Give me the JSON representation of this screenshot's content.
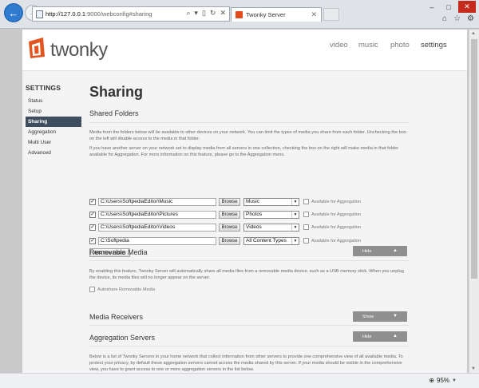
{
  "browser": {
    "url_host": "http://127.0.0.1",
    "url_rest": ":9000/webconfig#sharing",
    "tab_title": "Twonky Server",
    "zoom": "95%"
  },
  "brand": {
    "logo_text": "twonky",
    "accent": "#e2551f"
  },
  "topnav": [
    "video",
    "music",
    "photo",
    "settings"
  ],
  "sidebar": {
    "title": "SETTINGS",
    "items": [
      "Status",
      "Setup",
      "Sharing",
      "Aggregation",
      "Multi User",
      "Advanced"
    ],
    "active_index": 2
  },
  "main": {
    "title": "Sharing",
    "shared_folders": {
      "title": "Shared Folders",
      "para1": "Media from the folders below will be available to other devices on your network. You can limit the types of media you share from each folder. Unchecking the box on the left will disable access to the media in that folder.",
      "para2": "If you have another server on your network set to display media from all servers in one collection, checking the box on the right will make media in that folder available for Aggregation. For more information on this feature, please go to the Aggregation menu.",
      "browse_label": "Browse",
      "aggregation_label": "Available for Aggregation",
      "folders": [
        {
          "path": "C:\\Users\\SoftpediaEditor\\Music",
          "type": "Music",
          "checked": true
        },
        {
          "path": "C:\\Users\\SoftpediaEditor\\Pictures",
          "type": "Photos",
          "checked": true
        },
        {
          "path": "C:\\Users\\SoftpediaEditor\\Videos",
          "type": "Videos",
          "checked": true
        },
        {
          "path": "C:\\Softpedia",
          "type": "All Content Types",
          "checked": true
        }
      ],
      "add_button": "Add New Folder"
    },
    "removable_media": {
      "title": "Removable Media",
      "toggle_label": "Hide",
      "para": "By enabling this feature, Twonky Server will automatically share all media files from a removable media device, such as a USB memory stick. When you unplug the device, its media files will no longer appear on the server.",
      "autoshare_label": "Autoshare Removable Media"
    },
    "media_receivers": {
      "title": "Media Receivers",
      "toggle_label": "Show"
    },
    "aggregation_servers": {
      "title": "Aggregation Servers",
      "toggle_label": "Hide",
      "para": "Below is a list of Twonky Servers in your home network that collect information from other servers to provide one comprehensive view of all available media. To protect your privacy, by default these aggregation servers cannot access the media shared by this server. If your media should be visible in the comprehensive view, you have to grant access to one or more aggregation servers in the list below."
    }
  }
}
